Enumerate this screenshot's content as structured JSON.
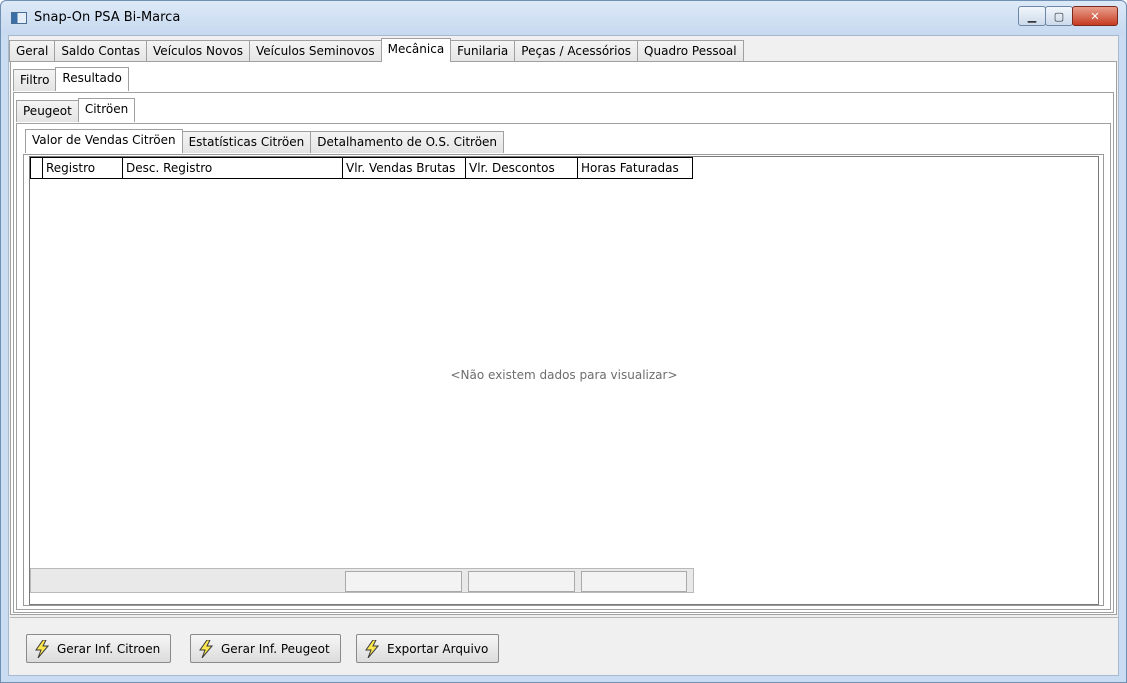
{
  "window": {
    "title": "Snap-On PSA Bi-Marca"
  },
  "main_tabs": [
    "Geral",
    "Saldo Contas",
    "Veículos Novos",
    "Veículos Seminovos",
    "Mecânica",
    "Funilaria",
    "Peças / Acessórios",
    "Quadro Pessoal"
  ],
  "main_tab_active": "Mecânica",
  "sub_tabs": [
    "Filtro",
    "Resultado"
  ],
  "sub_tab_active": "Resultado",
  "brand_tabs": [
    "Peugeot",
    "Citröen"
  ],
  "brand_tab_active": "Citröen",
  "report_tabs": [
    "Valor de Vendas Citröen",
    "Estatísticas Citröen",
    "Detalhamento de O.S. Citröen"
  ],
  "report_tab_active": "Valor de Vendas Citröen",
  "grid": {
    "columns": [
      "Registro",
      "Desc. Registro",
      "Vlr. Vendas Brutas",
      "Vlr. Descontos",
      "Horas Faturadas"
    ],
    "empty_message": "<Não existem dados para visualizar>"
  },
  "buttons": {
    "gerar_citroen": "Gerar Inf. Citroen",
    "gerar_peugeot": "Gerar Inf. Peugeot",
    "exportar": "Exportar Arquivo"
  },
  "icons": {
    "window": "app-icon",
    "button": "lightning-bolt-icon"
  },
  "colors": {
    "bolt_fill": "#ffe94d",
    "bolt_stroke": "#3a3a3a",
    "titlebar": "#c6d9f0"
  }
}
